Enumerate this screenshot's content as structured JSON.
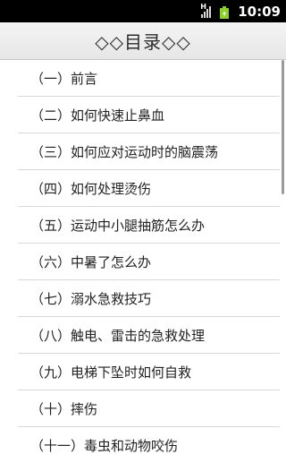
{
  "status_bar": {
    "time": "10:09",
    "signal_icon": "signal-strength-icon",
    "signal_glyph": "H",
    "battery_icon": "battery-charging-icon",
    "battery_color": "#8ccf2a"
  },
  "title_bar": {
    "title": "◇◇目录◇◇"
  },
  "list": {
    "items": [
      {
        "label": "（一）前言"
      },
      {
        "label": "（二）如何快速止鼻血"
      },
      {
        "label": "（三）如何应对运动时的脑震荡"
      },
      {
        "label": "（四）如何处理烫伤"
      },
      {
        "label": "（五）运动中小腿抽筋怎么办"
      },
      {
        "label": "（六）中暑了怎么办"
      },
      {
        "label": "（七）溺水急救技巧"
      },
      {
        "label": "（八）触电、雷击的急救处理"
      },
      {
        "label": "（九）电梯下坠时如何自救"
      },
      {
        "label": "（十）摔伤"
      },
      {
        "label": "（十一）毒虫和动物咬伤"
      }
    ]
  }
}
